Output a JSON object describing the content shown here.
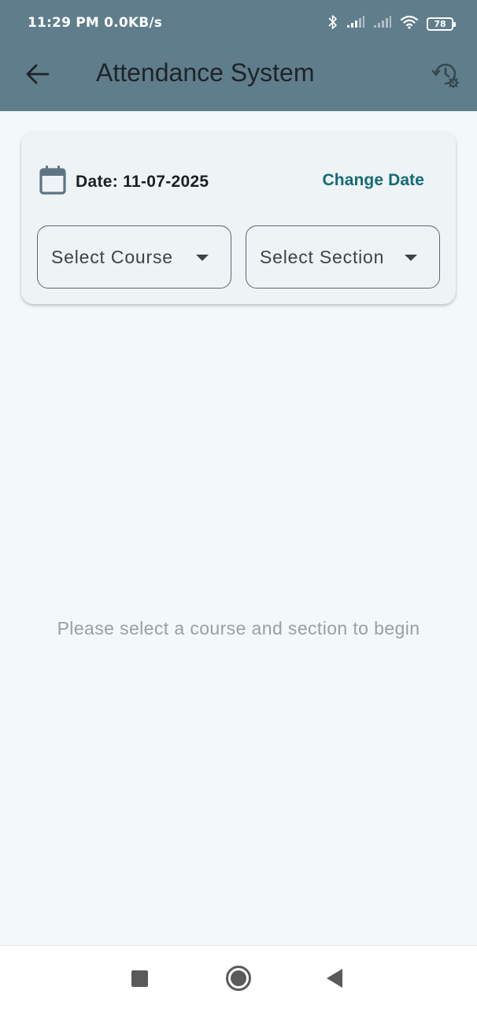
{
  "status_bar": {
    "time": "11:29 PM  0.0KB/s",
    "battery": "78",
    "icons": [
      "bluetooth-icon",
      "signal-icon",
      "signal-icon",
      "wifi-icon",
      "battery-icon"
    ]
  },
  "app_bar": {
    "title": "Attendance System",
    "back_icon": "arrow-left-icon",
    "action_icon": "history-settings-icon",
    "background": "#607d8b"
  },
  "filter_card": {
    "date_label": "Date: 11-07-2025",
    "date_icon": "calendar-icon",
    "change_date_label": "Change Date",
    "course_dropdown": {
      "selected": "Select Course"
    },
    "section_dropdown": {
      "selected": "Select Section"
    },
    "accent": "#146b76"
  },
  "main": {
    "empty_message": "Please select a course and section to begin"
  },
  "nav_bar": {
    "icons": [
      "recents-icon",
      "home-icon",
      "back-icon"
    ]
  }
}
